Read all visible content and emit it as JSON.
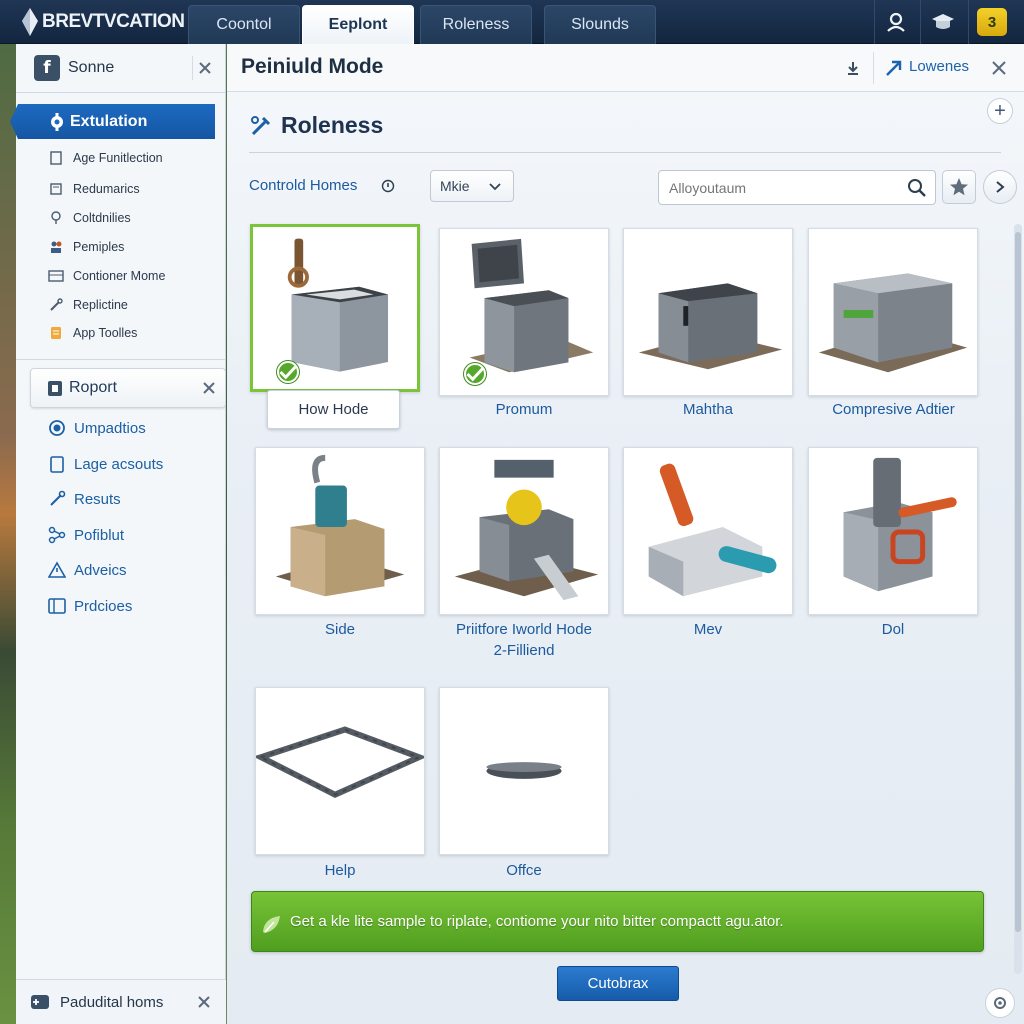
{
  "app": {
    "logo_text": "BREVTVCATION"
  },
  "top_tabs": [
    {
      "label": "Coontol",
      "active": false
    },
    {
      "label": "Eeplont",
      "active": true
    },
    {
      "label": "Roleness",
      "active": false
    },
    {
      "label": "Slounds",
      "active": false
    }
  ],
  "top_icons": [
    "user-icon",
    "graduation-cap-icon",
    "badge-icon"
  ],
  "top_badge": "3",
  "sidebar": {
    "header_label": "Sonne",
    "active_item": "Extulation",
    "small_items": [
      {
        "label": "Age Funitlection",
        "icon": "wrench-icon"
      },
      {
        "label": "Redumarics",
        "icon": "document-icon"
      },
      {
        "label": "Coltdnilies",
        "icon": "tree-icon"
      },
      {
        "label": "Pemiples",
        "icon": "people-icon"
      },
      {
        "label": "Contioner Mome",
        "icon": "container-icon"
      },
      {
        "label": "Replictine",
        "icon": "tools-icon"
      },
      {
        "label": "App Toolles",
        "icon": "app-icon"
      }
    ],
    "report_label": "Roport",
    "blue_items": [
      {
        "label": "Umpadtios",
        "icon": "radio-icon"
      },
      {
        "label": "Lage acsouts",
        "icon": "clipboard-icon"
      },
      {
        "label": "Resuts",
        "icon": "tools-icon"
      },
      {
        "label": "Pofiblut",
        "icon": "network-icon"
      },
      {
        "label": "Adveics",
        "icon": "alert-icon"
      },
      {
        "label": "Prdcioes",
        "icon": "panel-icon"
      }
    ],
    "bottom_label": "Padudital homs"
  },
  "main": {
    "title": "Peiniuld Mode",
    "header_link": "Lowenes",
    "section_title": "Roleness",
    "filter_label": "Controld Homes",
    "dropdown_value": "Mkie",
    "search_placeholder": "Alloyoutaum",
    "items": [
      {
        "label": "How Hode",
        "selected": true,
        "checked": true
      },
      {
        "label": "Promum",
        "selected": false,
        "checked": true
      },
      {
        "label": "Mahtha",
        "selected": false,
        "checked": false
      },
      {
        "label": "Compresive Adtier",
        "selected": false,
        "checked": false
      },
      {
        "label": "Side",
        "selected": false,
        "checked": false
      },
      {
        "label": "Priitfore Iworld Hode",
        "label_line2": "2-Filliend",
        "selected": false,
        "checked": false
      },
      {
        "label": "Mev",
        "selected": false,
        "checked": false
      },
      {
        "label": "Dol",
        "selected": false,
        "checked": false
      },
      {
        "label": "Help",
        "selected": false,
        "checked": false
      },
      {
        "label": "Offce",
        "selected": false,
        "checked": false
      }
    ],
    "banner_text": "Get a kle lite sample to riplate, contiome your nito bitter compactt agu.ator.",
    "primary_button": "Cutobrax"
  },
  "colors": {
    "accent_blue": "#1d6ac1",
    "topbar": "#1a2f4b",
    "success_green": "#5aa626",
    "selected_border": "#7ac43a"
  }
}
